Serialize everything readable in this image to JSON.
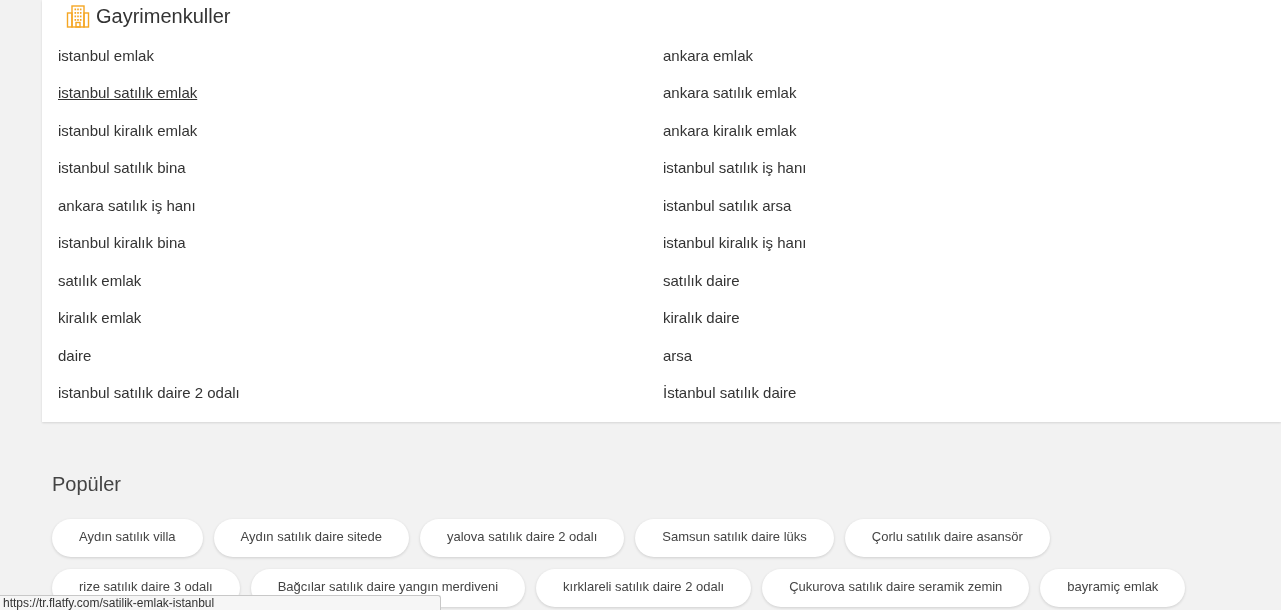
{
  "section": {
    "title": "Gayrimenkuller",
    "columns": [
      [
        {
          "text": "istanbul emlak",
          "underlined": false
        },
        {
          "text": "istanbul satılık emlak",
          "underlined": true
        },
        {
          "text": "istanbul kiralık emlak",
          "underlined": false
        },
        {
          "text": "istanbul satılık bina",
          "underlined": false
        },
        {
          "text": "ankara satılık iş hanı",
          "underlined": false
        },
        {
          "text": "istanbul kiralık bina",
          "underlined": false
        },
        {
          "text": "satılık emlak",
          "underlined": false
        },
        {
          "text": "kiralık emlak",
          "underlined": false
        },
        {
          "text": "daire",
          "underlined": false
        },
        {
          "text": "istanbul satılık daire 2 odalı",
          "underlined": false
        }
      ],
      [
        {
          "text": "ankara emlak",
          "underlined": false
        },
        {
          "text": "ankara satılık emlak",
          "underlined": false
        },
        {
          "text": "ankara kiralık emlak",
          "underlined": false
        },
        {
          "text": "istanbul satılık iş hanı",
          "underlined": false
        },
        {
          "text": "istanbul satılık arsa",
          "underlined": false
        },
        {
          "text": "istanbul kiralık iş hanı",
          "underlined": false
        },
        {
          "text": "satılık daire",
          "underlined": false
        },
        {
          "text": "kiralık daire",
          "underlined": false
        },
        {
          "text": "arsa",
          "underlined": false
        },
        {
          "text": "İstanbul satılık daire",
          "underlined": false
        }
      ]
    ]
  },
  "popular": {
    "title": "Popüler",
    "chips": [
      "Aydın satılık villa",
      "Aydın satılık daire sitede",
      "yalova satılık daire 2 odalı",
      "Samsun satılık daire lüks",
      "Çorlu satılık daire asansör",
      "rize satılık daire 3 odalı",
      "Bağcılar satılık daire yangın merdiveni",
      "kırklareli satılık daire 2 odalı",
      "Çukurova satılık daire seramik zemin",
      "bayramiç emlak"
    ]
  },
  "status_bar": {
    "url": "https://tr.flatfy.com/satilik-emlak-istanbul"
  }
}
